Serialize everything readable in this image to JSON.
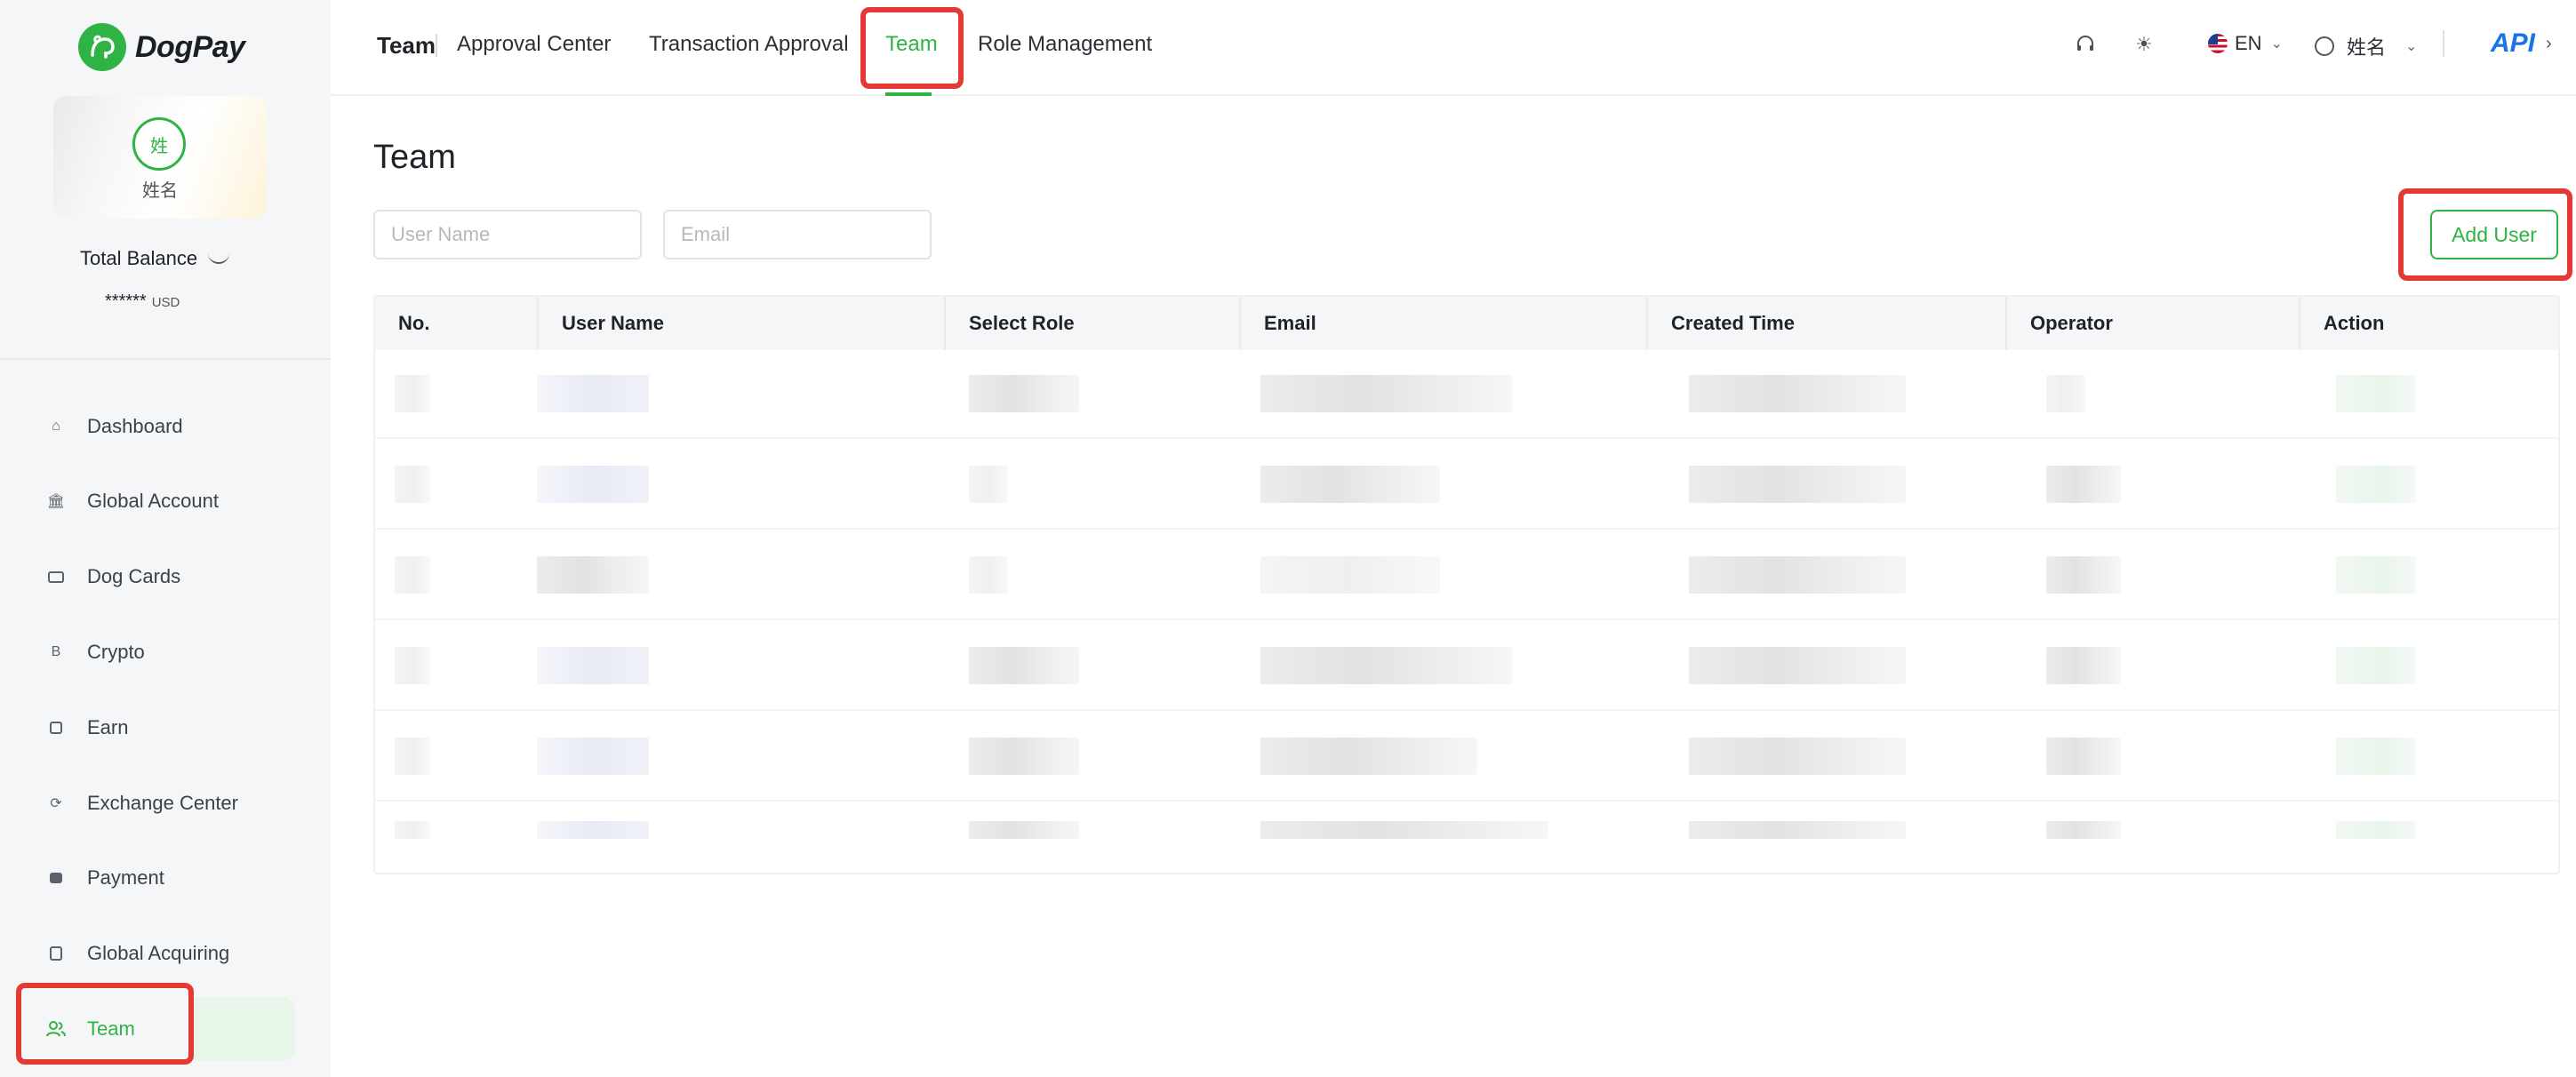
{
  "brand": {
    "name": "DogPay"
  },
  "profile": {
    "avatar_initial": "姓",
    "name": "姓名"
  },
  "balance": {
    "label": "Total Balance",
    "value": "******",
    "currency": "USD"
  },
  "sidebar": {
    "items": [
      {
        "label": "Dashboard",
        "icon": "home-icon"
      },
      {
        "label": "Global Account",
        "icon": "bank-icon"
      },
      {
        "label": "Dog Cards",
        "icon": "card-icon"
      },
      {
        "label": "Crypto",
        "icon": "bitcoin-icon"
      },
      {
        "label": "Earn",
        "icon": "earn-icon"
      },
      {
        "label": "Exchange Center",
        "icon": "exchange-icon"
      },
      {
        "label": "Payment",
        "icon": "wallet-icon"
      },
      {
        "label": "Global Acquiring",
        "icon": "acquiring-icon"
      },
      {
        "label": "Team",
        "icon": "team-icon",
        "active": true
      }
    ]
  },
  "header": {
    "section": "Team",
    "tabs": [
      {
        "label": "Approval Center"
      },
      {
        "label": "Transaction Approval"
      },
      {
        "label": "Team",
        "active": true
      },
      {
        "label": "Role Management"
      }
    ],
    "language": "EN",
    "user_name": "姓名",
    "api_label": "API"
  },
  "page": {
    "title": "Team",
    "filters": {
      "user_name_placeholder": "User Name",
      "email_placeholder": "Email"
    },
    "add_user_label": "Add User"
  },
  "table": {
    "columns": [
      "No.",
      "User Name",
      "Select Role",
      "Email",
      "Created Time",
      "Operator",
      "Action"
    ]
  },
  "colors": {
    "accent": "#2fb344",
    "api": "#1a73e8",
    "highlight": "#e53935"
  }
}
